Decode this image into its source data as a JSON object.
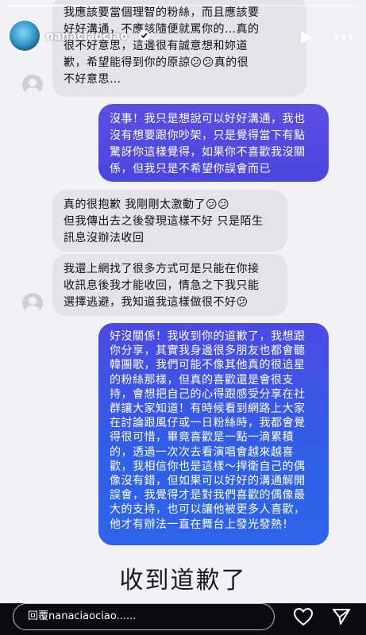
{
  "story": {
    "username": "nanaciaociao",
    "progress": 0.4
  },
  "messages": {
    "m1": {
      "lines": [
        "我應該要當個理智的粉絲，而且應該要",
        "好好溝通，不應該隨便就罵你的…真的",
        "很不好意思，這邊很有誠意想和妳道",
        "歉，希望能得到你的原諒😕😕真的很",
        "不好意思…"
      ]
    },
    "m2": {
      "lines": [
        "沒事！我只是想說可以好好溝通，我也",
        "沒有想要跟你吵架，只是覺得當下有點",
        "驚訝你這樣覺得，如果你不喜歡我沒關",
        "係，但我只是不希望你誤會而已"
      ]
    },
    "m3": {
      "lines": [
        "真的很抱歉 我剛剛太激動了😕😕",
        "但我傳出去之後發現這樣不好 只是陌生",
        "訊息沒辦法收回"
      ]
    },
    "m4": {
      "lines": [
        "我還上網找了很多方式可是只能在你接",
        "收訊息後我才能收回，情急之下我只能",
        "選擇逃避，我知道我這樣做很不好😕"
      ]
    },
    "m5": {
      "lines": [
        "好沒關係！我收到你的道歉了，我想跟",
        "你分享，其實我身邊很多朋友也都會聽",
        "韓團歌，我們可能不像其他真的很追星",
        "的粉絲那樣，但真的喜歡還是會很支",
        "持，會想把自己的心得跟感受分享在社",
        "群讓大家知道！有時候看到網路上大家",
        "在討論跟風仔或一日粉絲時，我都會覺",
        "得很可惜，畢竟喜歡是一點一滴累積",
        "的，透過一次次去看演唱會越來越喜",
        "歡，我相信你也是這樣～捍衛自己的偶",
        "像沒有錯，但如果可以好好的溝通解開",
        "誤會，我覺得才是對我們喜歡的偶像最",
        "大的支持，也可以讓他被更多人喜歡，",
        "他才有辦法一直在舞台上發光發熱！"
      ]
    }
  },
  "caption": "收到道歉了",
  "footer": {
    "reply_placeholder": "回覆nanaciaociao......"
  }
}
